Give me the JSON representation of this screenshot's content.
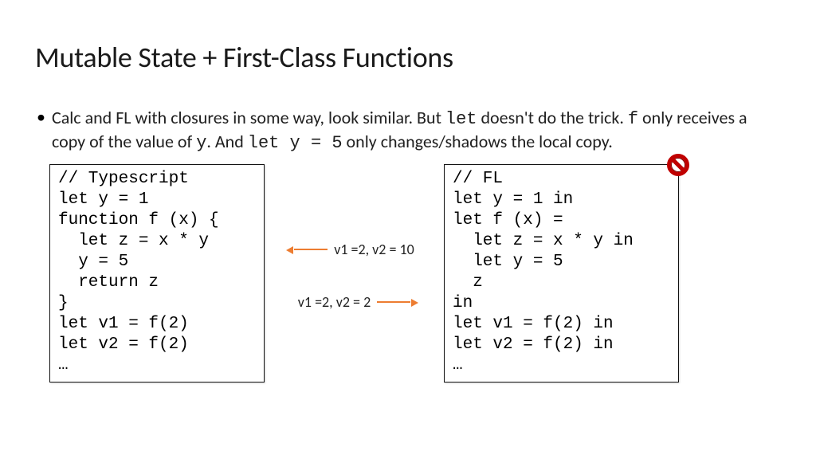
{
  "title": "Mutable State + First-Class Functions",
  "bullet": {
    "pre1": "Calc and FL with closures  in some way, look similar. But ",
    "code1": "let",
    "mid1": " doesn't do the trick. ",
    "code2": "f",
    "mid2": "  only receives a copy of the value of ",
    "code3": "y",
    "mid3": ".  And ",
    "code4": "let y = 5",
    "post": " only changes/shadows the local copy."
  },
  "left_code": "// Typescript\nlet y = 1\nfunction f (x) {\n  let z = x * y\n  y = 5\n  return z\n}\nlet v1 = f(2)\nlet v2 = f(2)\n…",
  "right_code": "// FL\nlet y = 1 in\nlet f (x) =\n  let z = x * y in\n  let y = 5\n  z\nin\nlet v1 = f(2) in\nlet v2 = f(2) in\n…",
  "annot_left": "v1 =2, v2 = 10",
  "annot_right": "v1 =2, v2 = 2"
}
